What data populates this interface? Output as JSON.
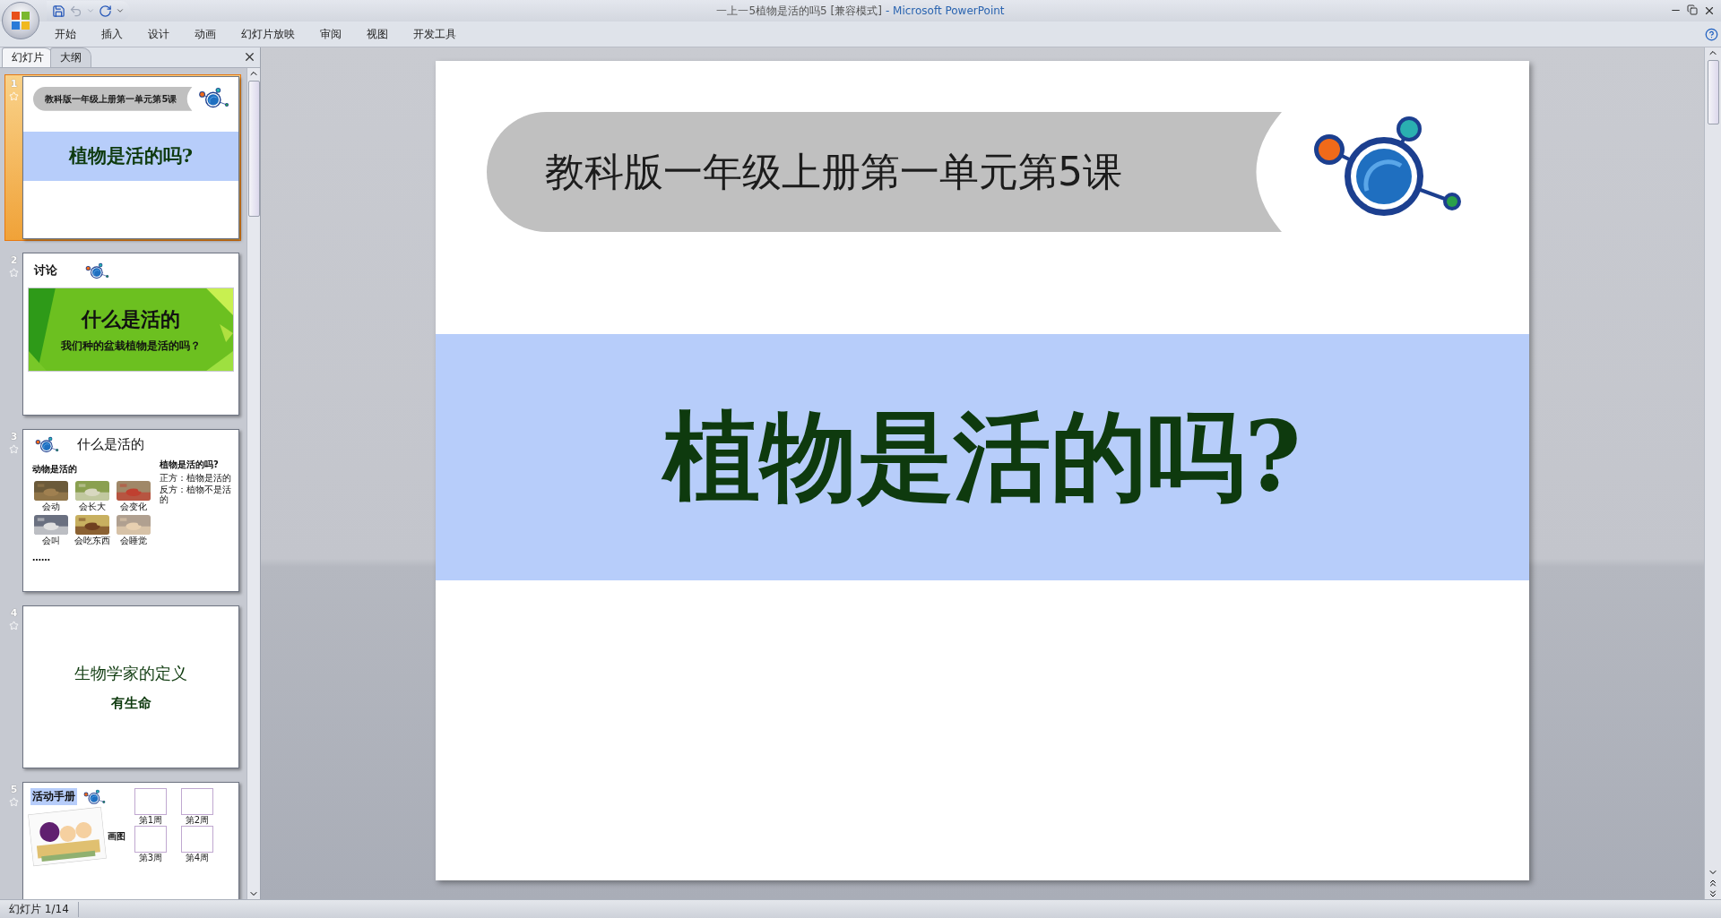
{
  "window": {
    "document": "一上一5植物是活的吗5 [兼容模式]",
    "app": "- Microsoft PowerPoint"
  },
  "ribbon_tabs": [
    {
      "label": "开始"
    },
    {
      "label": "插入"
    },
    {
      "label": "设计"
    },
    {
      "label": "动画"
    },
    {
      "label": "幻灯片放映"
    },
    {
      "label": "审阅"
    },
    {
      "label": "视图"
    },
    {
      "label": "开发工具"
    }
  ],
  "pane_tabs": [
    {
      "label": "幻灯片",
      "selected": true
    },
    {
      "label": "大纲",
      "selected": false
    }
  ],
  "thumbnails": [
    {
      "number": "1",
      "selected": true,
      "kind": "title",
      "banner": "教科版一年级上册第一单元第5课",
      "heading": "植物是活的吗?"
    },
    {
      "number": "2",
      "selected": false,
      "kind": "discussion",
      "title": "讨论",
      "heading": "什么是活的",
      "subheading": "我们种的盆栽植物是活的吗？"
    },
    {
      "number": "3",
      "selected": false,
      "kind": "list",
      "heading": "什么是活的",
      "left_heading": "动物是活的",
      "captions": [
        "会动",
        "会长大",
        "会变化",
        "会叫",
        "会吃东西",
        "会睡觉"
      ],
      "ellipsis": "……",
      "right_heading": "植物是活的吗?",
      "bullets": [
        "正方：植物是活的",
        "反方：植物不是活的"
      ]
    },
    {
      "number": "4",
      "selected": false,
      "kind": "definition",
      "line1": "生物学家的定义",
      "line2": "有生命"
    },
    {
      "number": "5",
      "selected": false,
      "kind": "handbook",
      "title": "活动手册",
      "label": "画图",
      "weeks": [
        "第1周",
        "第2周",
        "第3周",
        "第4周"
      ]
    }
  ],
  "slide": {
    "banner": "教科版一年级上册第一单元第5课",
    "heading": "植物是活的吗?"
  },
  "status_bar": {
    "text": "幻灯片 1/14"
  }
}
